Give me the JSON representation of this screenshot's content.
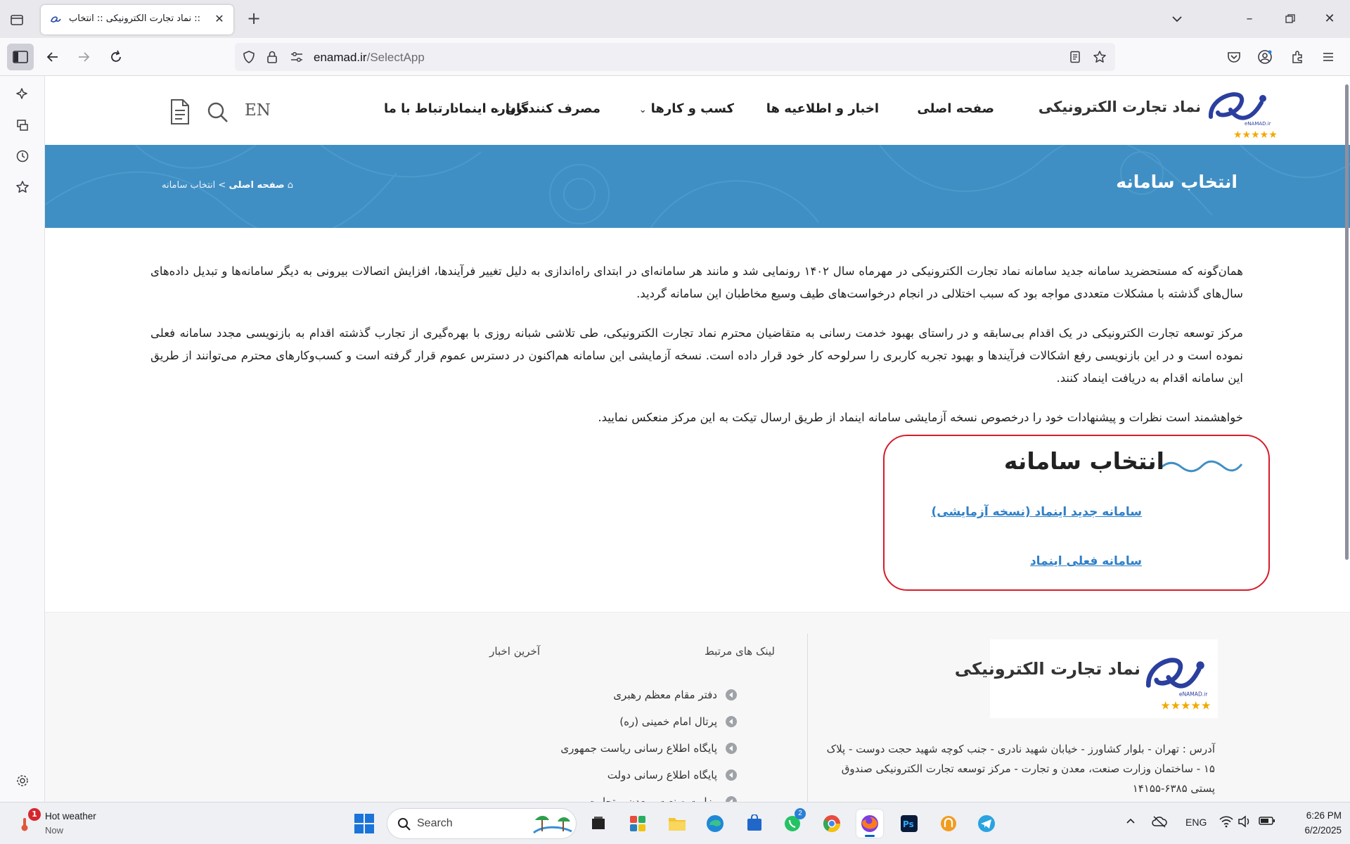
{
  "browser": {
    "tab_title": ":: نماد تجارت الکترونیکی :: انتخاب",
    "url_domain": "enamad.ir",
    "url_path": "/SelectApp"
  },
  "site": {
    "logo_text": "نماد تجارت الکترونیکی",
    "nav": [
      {
        "label": "صفحه اصلی"
      },
      {
        "label": "اخبار و اطلاعیه ها"
      },
      {
        "label": "کسب و کارها"
      },
      {
        "label": "مصرف کنندگان"
      },
      {
        "label": "درباره اینماد"
      },
      {
        "label": "ارتباط با ما"
      }
    ],
    "lang": "EN",
    "banner_title": "انتخاب سامانه",
    "breadcrumb_home": "صفحه اصلی",
    "breadcrumb_sep": ">",
    "breadcrumb_current": "انتخاب سامانه",
    "intro": [
      "همان‌گونه که مستحضرید سامانه جدید سامانه نماد تجارت الکترونیکی در مهرماه سال ۱۴۰۲ رونمایی شد و مانند هر سامانه‌ای در ابتدای راه‌اندازی به دلیل تغییر فرآیندها، افزایش اتصالات بیرونی به دیگر سامانه‌ها و تبدیل داده‌های سال‌های گذشته با مشکلات متعددی مواجه بود که سبب اختلالی در انجام درخواست‌های طیف وسیع مخاطبان این سامانه گردید.",
      "مرکز توسعه تجارت الکترونیکی در یک اقدام بی‌سابقه و در راستای بهبود خدمت رسانی به متقاضیان محترم نماد تجارت الکترونیکی، طی تلاشی شبانه روزی با بهره‌گیری از تجارب گذشته اقدام به بازنویسی مجدد سامانه فعلی نموده است و در این بازنویسی رفع اشکالات فرآیندها و بهبود تجربه کاربری را سرلوحه کار خود قرار داده است. نسخه آزمایشی این سامانه هم‌اکنون در دسترس عموم قرار گرفته است و کسب‌وکارهای محترم می‌توانند از طریق این سامانه اقدام به دریافت اینماد کنند.",
      "خواهشمند است نظرات و پیشنهادات خود را درخصوص نسخه آزمایشی سامانه اینماد از طریق ارسال تیکت به این مرکز منعکس نمایید."
    ],
    "select_title": "انتخاب سامانه",
    "link_new": "سامانه جدید اینماد (نسخه آزمایشی)",
    "link_current": "سامانه فعلی اینماد",
    "footer": {
      "logo_text": "نماد تجارت الکترونیکی",
      "address": "آدرس : تهران - بلوار کشاورز - خیابان شهید نادری - جنب کوچه شهید حجت دوست - پلاک ۱۵ - ساختمان وزارت صنعت، معدن و تجارت - مرکز توسعه تجارت الکترونیکی صندوق پستی ۶۳۸۵-۱۴۱۵۵",
      "links_title": "لینک های مرتبط",
      "news_title": "آخرین اخبار",
      "links": [
        {
          "label": "دفتر مقام معظم رهبری"
        },
        {
          "label": "پرتال امام خمینی (ره)"
        },
        {
          "label": "پایگاه اطلاع رسانی ریاست جمهوری"
        },
        {
          "label": "پایگاه اطلاع رسانی دولت"
        },
        {
          "label": "وزارت صنعت، معدن و تجارت"
        }
      ]
    }
  },
  "taskbar": {
    "weather_title": "Hot weather",
    "weather_sub": "Now",
    "weather_badge": "1",
    "search_placeholder": "Search",
    "whatsapp_badge": "2",
    "lang": "ENG",
    "time": "6:26 PM",
    "date": "6/2/2025"
  },
  "colors": {
    "banner": "#3f8fc4",
    "link": "#2f7fc7",
    "highlight": "#d81b2a"
  }
}
